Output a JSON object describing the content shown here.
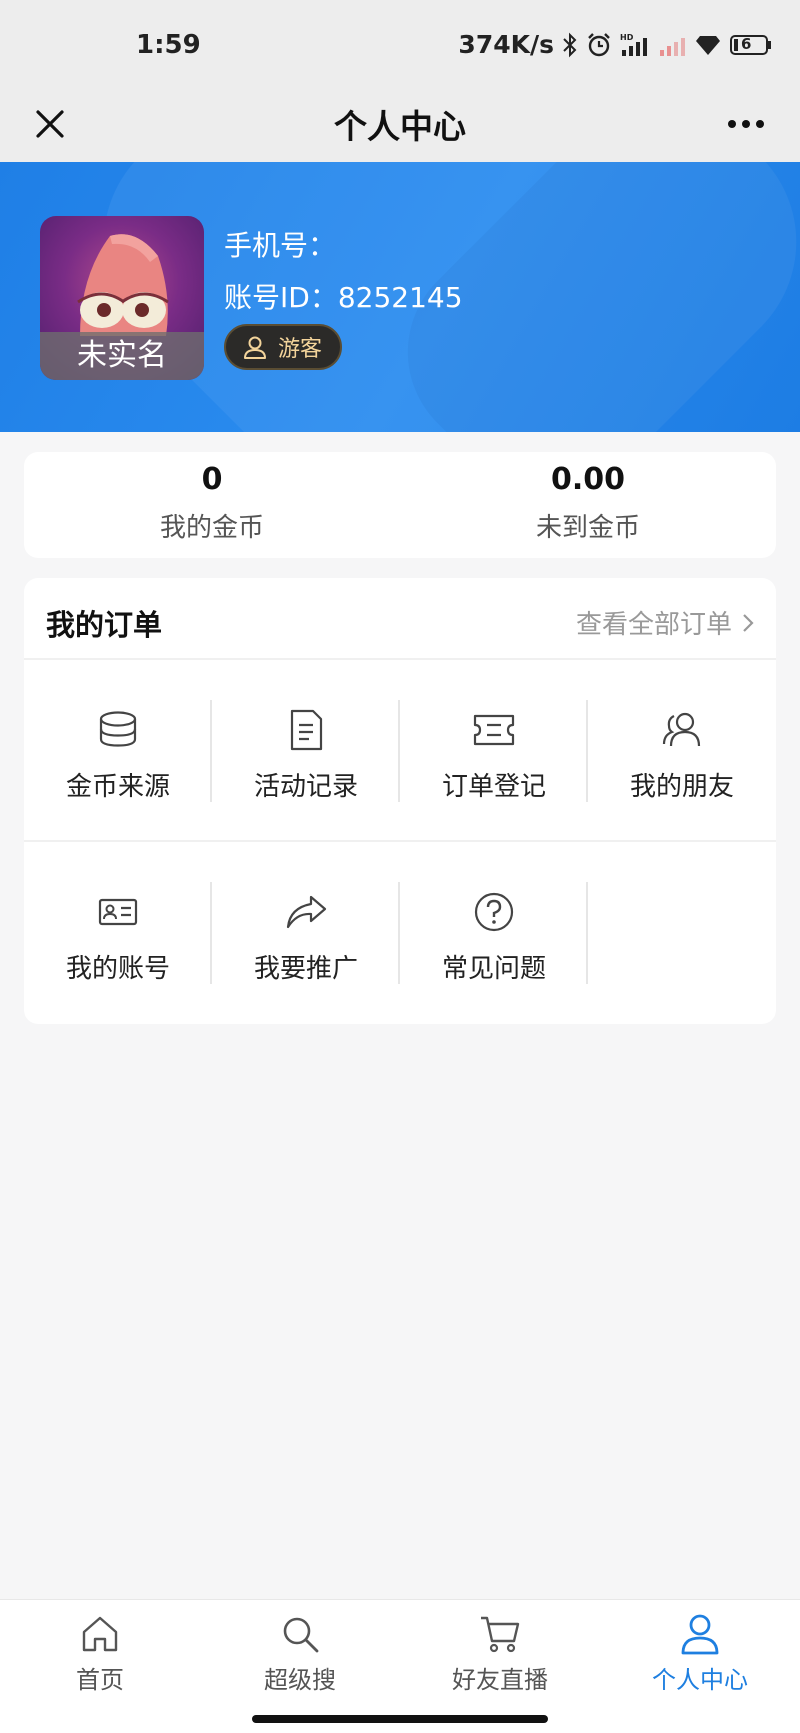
{
  "status_bar": {
    "time": "1:59",
    "network_speed": "374K/s",
    "battery_level": "6",
    "icons": [
      "bluetooth-icon",
      "alarm-icon",
      "signal-hd-icon",
      "signal-icon",
      "wifi-icon",
      "battery-icon"
    ]
  },
  "nav": {
    "title": "个人中心",
    "close_icon": "close-icon",
    "more_icon": "more-icon"
  },
  "profile": {
    "avatar_label": "未实名",
    "phone_label": "手机号：",
    "account_id": "账号ID：8252145",
    "badge_label": "游客",
    "badge_icon": "user-icon",
    "banner_color": "#2689ee"
  },
  "coins": [
    {
      "value": "0",
      "label": "我的金币"
    },
    {
      "value": "0.00",
      "label": "未到金币"
    }
  ],
  "orders": {
    "title": "我的订单",
    "view_all": "查看全部订单",
    "items": [
      {
        "label": "金币来源",
        "icon": "coins-icon"
      },
      {
        "label": "活动记录",
        "icon": "document-icon"
      },
      {
        "label": "订单登记",
        "icon": "ticket-icon"
      },
      {
        "label": "我的朋友",
        "icon": "friends-icon"
      },
      {
        "label": "我的账号",
        "icon": "id-card-icon"
      },
      {
        "label": "我要推广",
        "icon": "share-icon"
      },
      {
        "label": "常见问题",
        "icon": "question-icon"
      }
    ]
  },
  "tabs": [
    {
      "label": "首页",
      "icon": "home-icon",
      "active": false
    },
    {
      "label": "超级搜",
      "icon": "search-icon",
      "active": false
    },
    {
      "label": "好友直播",
      "icon": "cart-icon",
      "active": false
    },
    {
      "label": "个人中心",
      "icon": "person-icon",
      "active": true
    }
  ],
  "colors": {
    "accent": "#1e7fe0",
    "badge_text": "#f3d49b",
    "badge_bg": "#2b2a28"
  }
}
